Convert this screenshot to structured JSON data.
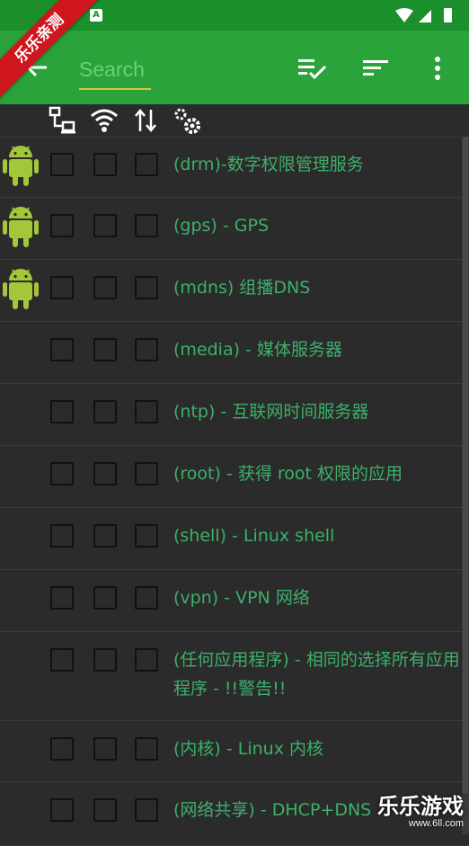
{
  "search": {
    "placeholder": "Search"
  },
  "ribbon_text": "乐乐亲测",
  "watermark": {
    "brand": "乐乐游戏",
    "url": "www.6ll.com"
  },
  "colors": {
    "appbar": "#29a33a",
    "statusbar": "#1b8f2c",
    "label": "#3cb06a",
    "android": "#a4c639"
  },
  "header_icons": [
    "lan-icon",
    "wifi-icon",
    "data-transfer-icon",
    "settings-icon"
  ],
  "appbar_actions": [
    "back-arrow-icon",
    "select-all-icon",
    "sort-icon",
    "more-vert-icon"
  ],
  "rows": [
    {
      "label": "(drm)-数字权限管理服务",
      "android": true
    },
    {
      "label": "(gps) - GPS",
      "android": true
    },
    {
      "label": "(mdns) 组播DNS",
      "android": true
    },
    {
      "label": "(media) - 媒体服务器",
      "android": false
    },
    {
      "label": "(ntp) - 互联网时间服务器",
      "android": false
    },
    {
      "label": "(root) - 获得 root 权限的应用",
      "android": false
    },
    {
      "label": "(shell) - Linux shell",
      "android": false
    },
    {
      "label": "(vpn) - VPN 网络",
      "android": false
    },
    {
      "label": "(任何应用程序) - 相同的选择所有应用程序 - !!警告!!",
      "android": false
    },
    {
      "label": "(内核) - Linux 内核",
      "android": false
    },
    {
      "label": "(网络共享) - DHCP+DNS",
      "android": false
    }
  ]
}
